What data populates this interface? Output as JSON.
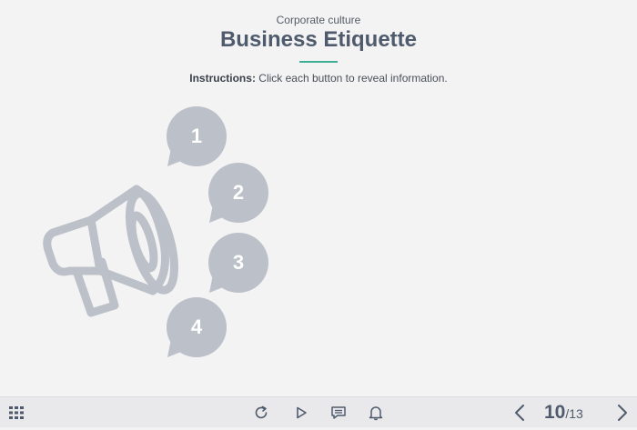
{
  "slide": {
    "subtitle": "Corporate culture",
    "title": "Business Etiquette",
    "instructions_label": "Instructions:",
    "instructions_text": " Click each button to reveal information.",
    "accent_color": "#3fae96",
    "bubble_color": "#bcc0c8",
    "bubbles": [
      {
        "label": "1"
      },
      {
        "label": "2"
      },
      {
        "label": "3"
      },
      {
        "label": "4"
      }
    ],
    "illustration_icon": "megaphone-icon"
  },
  "player": {
    "menu_icon": "grid-menu-icon",
    "replay_icon": "replay-icon",
    "play_icon": "play-icon",
    "notes_icon": "notes-icon",
    "notify_icon": "bell-icon",
    "prev_icon": "chevron-left-icon",
    "next_icon": "chevron-right-icon",
    "page_current": "10",
    "page_total": "/13"
  }
}
